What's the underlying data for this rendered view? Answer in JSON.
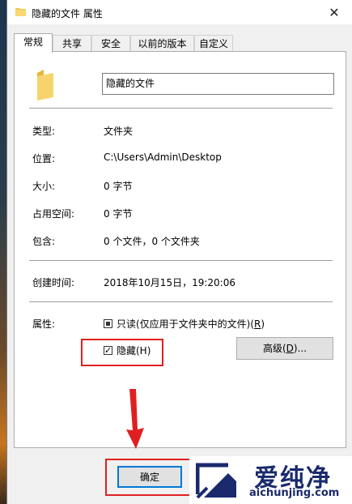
{
  "window": {
    "title": "隐藏的文件 属性",
    "close_label": "✕"
  },
  "tabs": [
    "常规",
    "共享",
    "安全",
    "以前的版本",
    "自定义"
  ],
  "general": {
    "name_value": "隐藏的文件",
    "type_label": "类型:",
    "type_value": "文件夹",
    "location_label": "位置:",
    "location_value": "C:\\Users\\Admin\\Desktop",
    "size_label": "大小:",
    "size_value": "0 字节",
    "disk_size_label": "占用空间:",
    "disk_size_value": "0 字节",
    "contains_label": "包含:",
    "contains_value": "0 个文件，0 个文件夹",
    "created_label": "创建时间:",
    "created_value": "2018年10月15日，19:20:06",
    "attributes_label": "属性:",
    "readonly_label": "只读(仅应用于文件夹中的文件)(",
    "readonly_key": "R",
    "readonly_close": ")",
    "hidden_label": "隐藏(H)",
    "advanced_label": "高级(",
    "advanced_key": "D",
    "advanced_close": ")..."
  },
  "buttons": {
    "ok": "确定"
  },
  "watermark": {
    "title": "爱纯净",
    "url": "aichunjing.com"
  },
  "colors": {
    "highlight": "#e02020",
    "folder": "#f4c64d"
  }
}
